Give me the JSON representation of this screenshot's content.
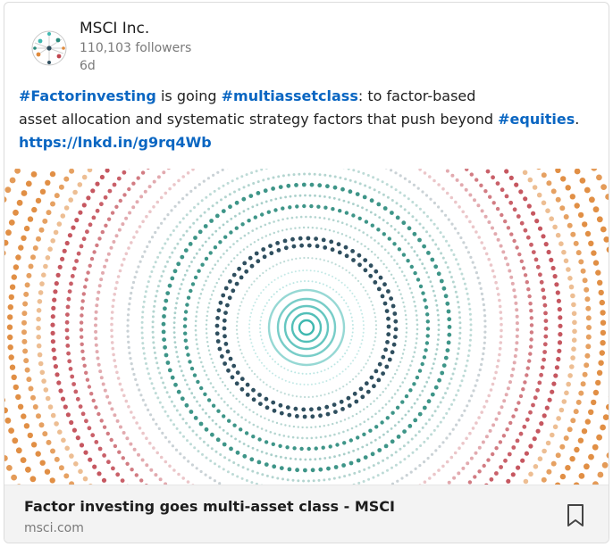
{
  "post": {
    "author": {
      "name": "MSCI Inc.",
      "followers": "110,103 followers",
      "age": "6d"
    },
    "text": {
      "line1": {
        "tag1": "#Factorinvesting",
        "mid": " is going ",
        "tag2": "#multiassetclass",
        "end": ": to factor-based"
      },
      "line2": {
        "start": "asset allocation and systematic strategy factors that push beyond ",
        "tag3": "#equities",
        "end": "."
      },
      "link": "https://lnkd.in/g9rq4Wb"
    },
    "article": {
      "title": "Factor investing goes multi-asset class - MSCI",
      "source": "msci.com"
    },
    "icons": {
      "logo": "msci-globe-logo",
      "save": "bookmark-icon"
    },
    "colors": {
      "link": "#0a66c2",
      "ring_orange": "#e08a3c",
      "ring_red": "#c0454f",
      "ring_teal": "#2a8a7c",
      "ring_dark": "#2f4f5f",
      "ring_cyan": "#3fb8b0"
    }
  }
}
